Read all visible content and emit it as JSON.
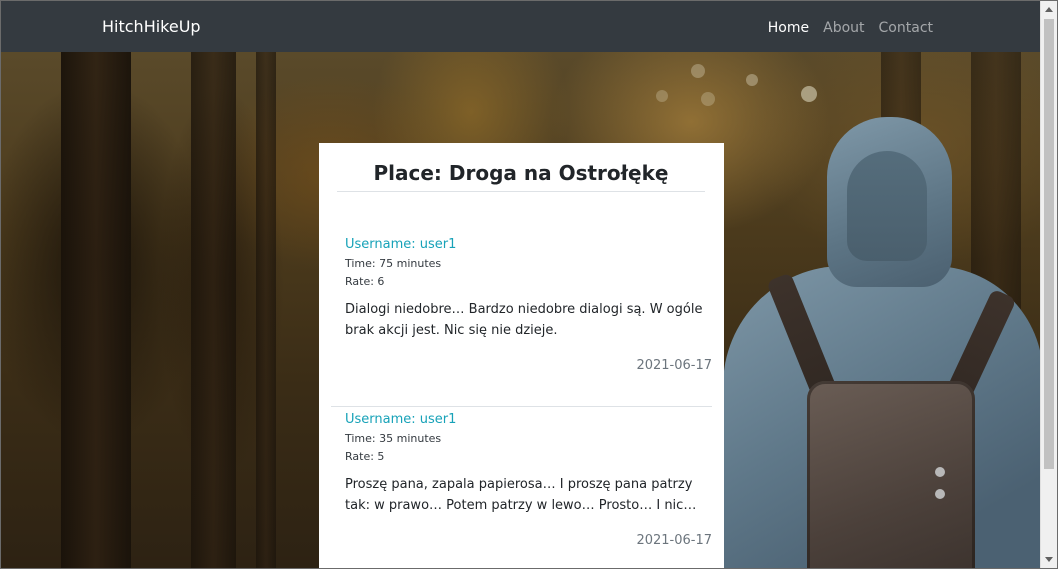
{
  "navbar": {
    "brand": "HitchHikeUp",
    "links": [
      {
        "label": "Home",
        "active": true
      },
      {
        "label": "About",
        "active": false
      },
      {
        "label": "Contact",
        "active": false
      }
    ]
  },
  "place": {
    "title": "Place: Droga na Ostrołękę"
  },
  "reviews": [
    {
      "username": "Username: user1",
      "time": "Time: 75 minutes",
      "rate": "Rate: 6",
      "body": "Dialogi niedobre… Bardzo niedobre dialogi są. W ogóle brak akcji jest. Nic się nie dzieje.",
      "date": "2021-06-17"
    },
    {
      "username": "Username: user1",
      "time": "Time: 35 minutes",
      "rate": "Rate: 5",
      "body": "Proszę pana, zapala papierosa… I proszę pana patrzy tak: w prawo… Potem patrzy w lewo… Prosto… I nic…",
      "date": "2021-06-17"
    }
  ],
  "colors": {
    "navbar_bg": "#343a40",
    "link_accent": "#17a2b8",
    "card_bg": "#ffffff"
  },
  "icons": {
    "scroll_up": "scroll-up-arrow-icon",
    "scroll_down": "scroll-down-arrow-icon"
  }
}
